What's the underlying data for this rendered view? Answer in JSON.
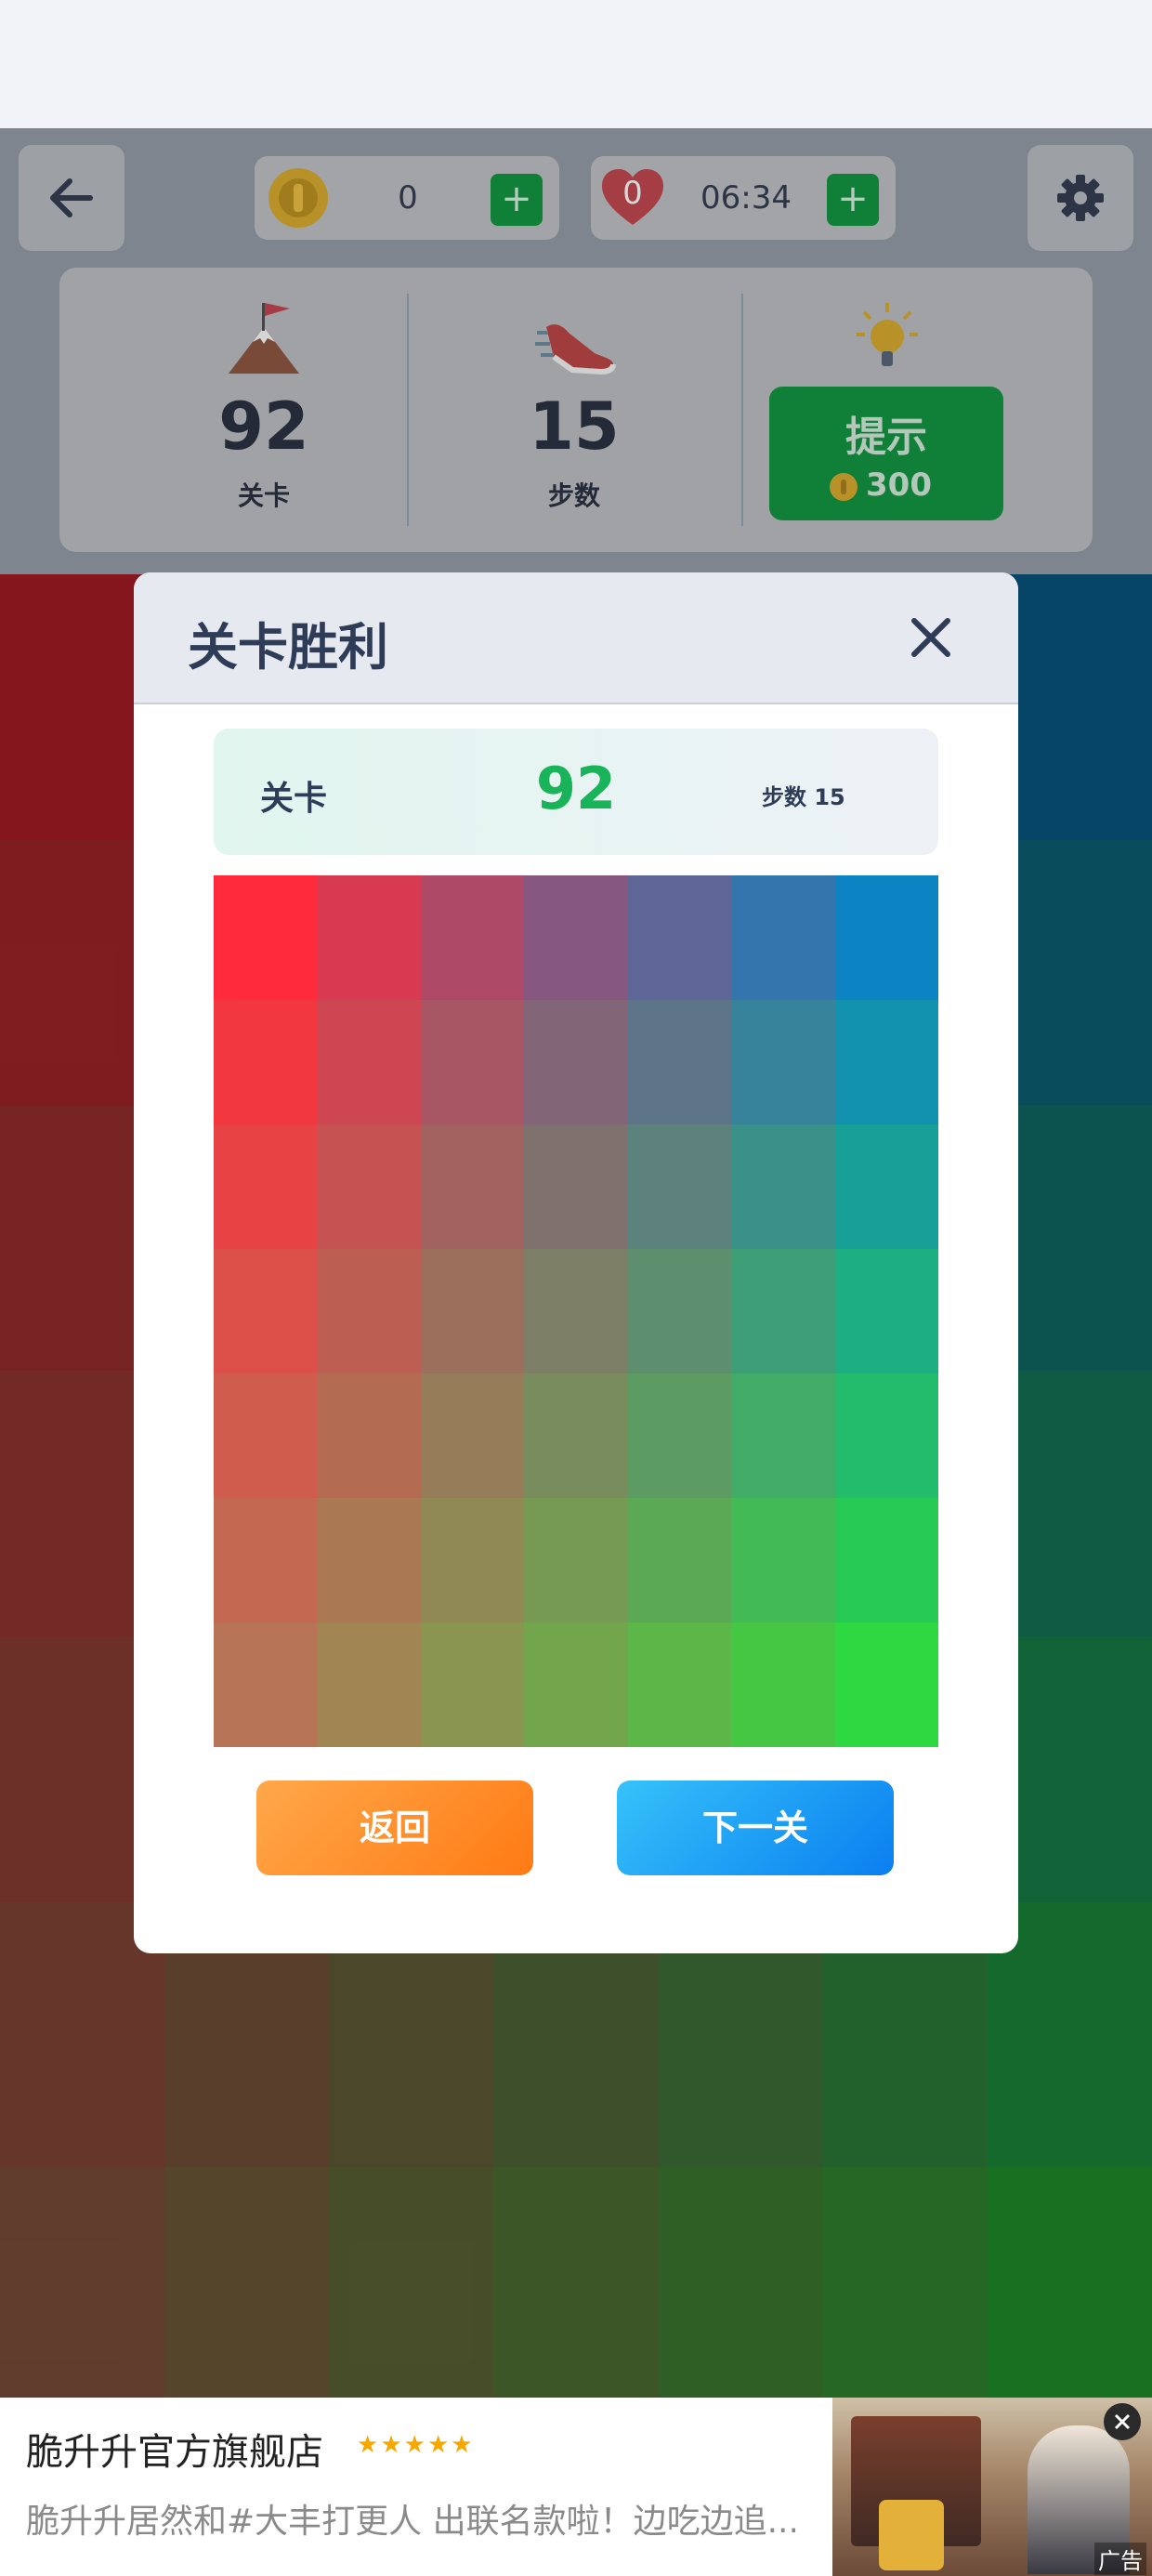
{
  "status_bar": {},
  "header": {
    "coins": "0",
    "lives": "0",
    "timer": "06:34",
    "plus": "+"
  },
  "stats": {
    "level_value": "92",
    "level_label": "关卡",
    "steps_value": "15",
    "steps_label": "步数",
    "hint_label": "提示",
    "hint_cost": "300"
  },
  "dialog": {
    "title": "关卡胜利",
    "level_label": "关卡",
    "level_value": "92",
    "steps_text": "步数 15",
    "back_label": "返回",
    "next_label": "下一关"
  },
  "ad": {
    "store_name": "脆升升官方旗舰店",
    "description": "脆升升居然和#大丰打更人 出联名款啦！边吃边追...",
    "ad_tag": "广告",
    "rating_stars": 5
  },
  "colors": {
    "top_left": "#ff2b3a",
    "top_right": "#0c84c4",
    "bottom_left": "#b87457",
    "bottom_right": "#2ed840",
    "accent_green": "#107f37",
    "level_green": "#19b45a",
    "back_orange": "#ff8a22",
    "next_blue": "#1a9af4"
  },
  "puzzle_grid": {
    "rows": 7,
    "cols": 7
  }
}
